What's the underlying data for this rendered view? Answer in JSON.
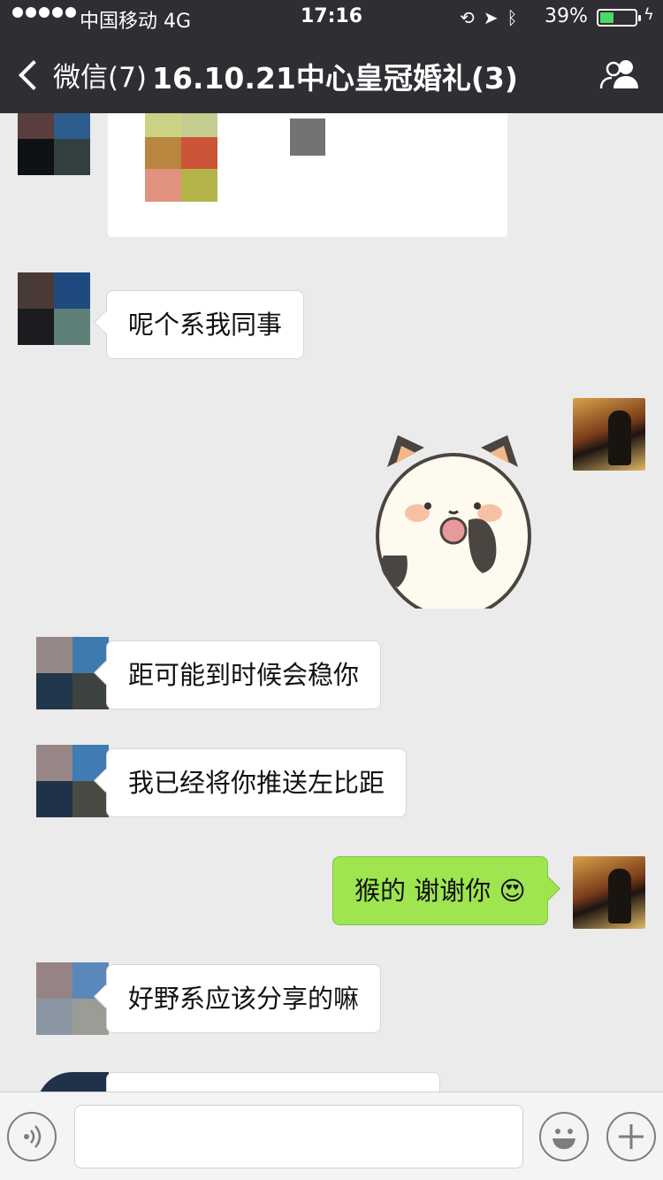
{
  "status_bar": {
    "carrier": "中国移动  4G",
    "time": "17:16",
    "battery_percent": "39%",
    "battery_level": 0.39
  },
  "nav": {
    "back_label": "微信(7)",
    "title": "16.10.21中心皇冠婚礼(3)"
  },
  "messages": [
    {
      "side": "left",
      "type": "image"
    },
    {
      "side": "left",
      "text": "呢个系我同事"
    },
    {
      "side": "right",
      "type": "sticker",
      "sticker": "panda-sticker"
    },
    {
      "side": "left",
      "text": "距可能到时候会稳你"
    },
    {
      "side": "left",
      "text": "我已经将你推送左比距"
    },
    {
      "side": "right",
      "text": "猴的  谢谢你",
      "emoji": "😍"
    },
    {
      "side": "left",
      "text": "好野系应该分享的嘛"
    },
    {
      "side": "left",
      "type": "partial"
    }
  ],
  "input_bar": {
    "voice_icon": "voice-icon",
    "emoji_icon": "emoji-icon",
    "add_icon": "plus-icon"
  },
  "colors": {
    "header_bg": "#2e2e33",
    "chat_bg": "#ebebeb",
    "sent_bubble": "#9ee550"
  }
}
